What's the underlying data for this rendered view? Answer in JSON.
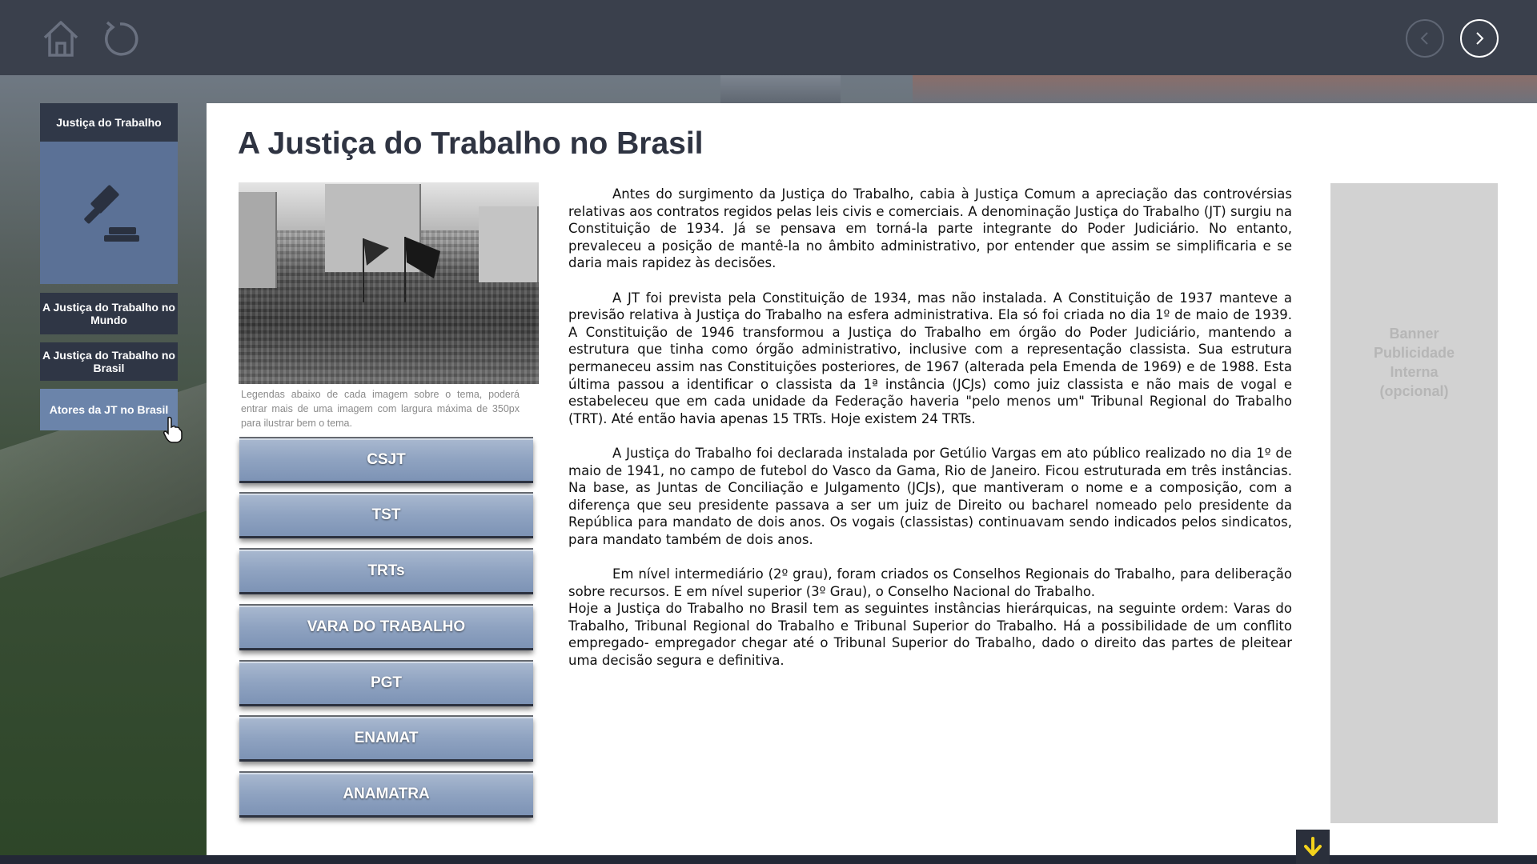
{
  "topbar": {
    "home_icon": "home-icon",
    "refresh_icon": "refresh-icon",
    "prev_icon": "chevron-left-icon",
    "next_icon": "chevron-right-icon"
  },
  "sidebar": {
    "card_title": "Justiça do Trabalho",
    "card_icon": "gavel-icon",
    "items": [
      {
        "label": "A Justiça do Trabalho no Mundo"
      },
      {
        "label": "A Justiça do Trabalho no Brasil"
      },
      {
        "label": "Atores da JT no Brasil"
      }
    ]
  },
  "main": {
    "title": "A Justiça do Trabalho no Brasil",
    "caption": "Legendas abaixo de cada imagem sobre o tema, poderá entrar mais de uma imagem com largura máxima de 350px para ilustrar bem o tema.",
    "buttons": [
      "CSJT",
      "TST",
      "TRTs",
      "VARA DO TRABALHO",
      "PGT",
      "ENAMAT",
      "ANAMATRA"
    ],
    "paragraphs": [
      "Antes do surgimento da Justiça do Trabalho, cabia à Justiça Comum a apreciação das controvérsias relativas aos contratos regidos pelas leis civis e comerciais. A denominação Justiça do Trabalho (JT) surgiu na Constituição de 1934. Já se pensava em torná-la parte integrante do Poder Judiciário. No entanto, prevaleceu a posição de mantê-la no âmbito administrativo, por entender que assim se simplificaria e se daria mais rapidez às decisões.",
      "A JT foi prevista pela Constituição de 1934, mas não instalada. A Constituição de 1937 manteve a previsão relativa à Justiça do Trabalho na esfera administrativa. Ela só foi criada no dia 1º de maio de 1939. A Constituição de 1946 transformou a Justiça do Trabalho em órgão do Poder Judiciário, mantendo a estrutura que tinha como órgão administrativo, inclusive com a representação classista. Sua estrutura permaneceu assim nas Constituições posteriores, de 1967 (alterada pela Emenda de 1969) e de 1988. Esta última passou a identificar o classista da 1ª instância (JCJs) como juiz classista e não mais de vogal e estabeleceu que em cada unidade da Federação haveria \"pelo menos um\" Tribunal Regional do Trabalho (TRT). Até então havia apenas 15 TRTs. Hoje existem 24 TRTs.",
      "A Justiça do Trabalho foi declarada instalada por Getúlio Vargas em ato público realizado no dia 1º de maio de 1941, no campo de futebol do Vasco da Gama, Rio de Janeiro. Ficou estruturada em três instâncias. Na base, as Juntas de Conciliação e Julgamento (JCJs), que mantiveram o nome e a composição, com a diferença que seu presidente passava a ser um juiz de Direito ou bacharel nomeado pelo presidente da República para mandato de dois anos. Os vogais (classistas) continuavam sendo indicados pelos sindicatos, para mandato também de dois anos.",
      "Em nível intermediário (2º grau), foram criados os Conselhos Regionais do Trabalho, para deliberação sobre recursos. E em nível superior (3º Grau), o Conselho Nacional do Trabalho.",
      "Hoje a Justiça do Trabalho no Brasil tem as seguintes instâncias hierárquicas, na seguinte ordem: Varas do Trabalho, Tribunal Regional do Trabalho e Tribunal Superior do Trabalho. Há a possibilidade de um conflito empregado- empregador chegar até o Tribunal Superior do Trabalho, dado o direito das partes de pleitear uma decisão segura e definitiva."
    ]
  },
  "banner": {
    "text": "Banner Publicidade Interna (opcional)"
  },
  "scroll_icon": "arrow-down-icon",
  "colors": {
    "topbar": "#3a404c",
    "sidebar_card": "#5b7196",
    "sidebar_dark": "#2f3645",
    "sidebar_active": "#6b84aa",
    "button": "#8fa3c1",
    "banner": "#d2d2d2",
    "accent_yellow": "#f3d21c"
  }
}
